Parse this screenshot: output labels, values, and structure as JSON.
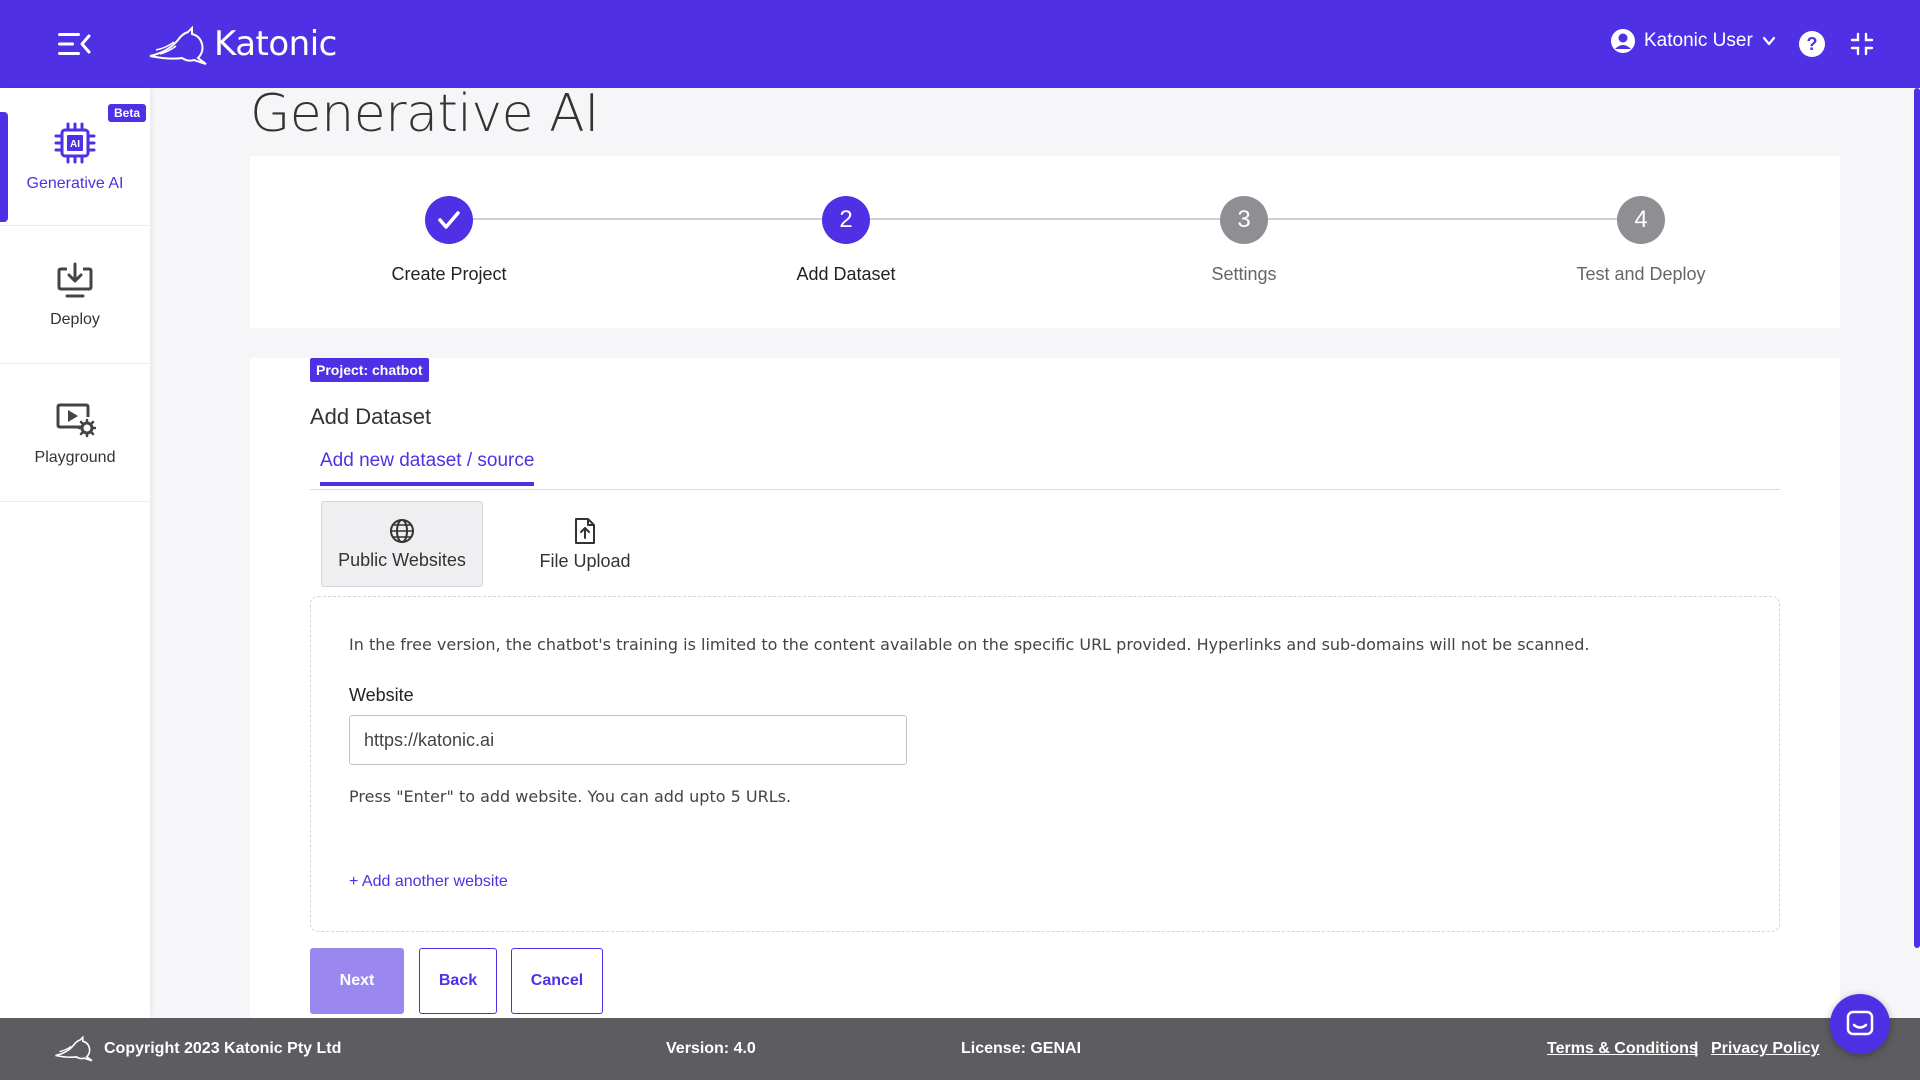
{
  "header": {
    "brand": "Katonic",
    "user_name": "Katonic User"
  },
  "sidebar": {
    "items": [
      {
        "label": "Generative AI",
        "badge": "Beta"
      },
      {
        "label": "Deploy"
      },
      {
        "label": "Playground"
      }
    ]
  },
  "page": {
    "title": "Generative AI"
  },
  "stepper": {
    "steps": [
      {
        "number": "1",
        "label": "Create Project",
        "state": "done"
      },
      {
        "number": "2",
        "label": "Add Dataset",
        "state": "current"
      },
      {
        "number": "3",
        "label": "Settings",
        "state": "todo"
      },
      {
        "number": "4",
        "label": "Test and Deploy",
        "state": "todo"
      }
    ]
  },
  "content": {
    "project_badge": "Project: chatbot",
    "section_title": "Add Dataset",
    "tab_label": "Add new dataset / source",
    "sources": [
      {
        "label": "Public Websites",
        "selected": true
      },
      {
        "label": "File Upload",
        "selected": false
      }
    ],
    "info_text": "In the free version, the chatbot's training is limited to the content available on the specific URL provided. Hyperlinks and sub-domains will not be scanned.",
    "website_label": "Website",
    "website_value": "https://katonic.ai",
    "hint_text": "Press \"Enter\" to add website. You can add upto 5 URLs.",
    "add_link": "+ Add another website"
  },
  "actions": {
    "next": "Next",
    "back": "Back",
    "cancel": "Cancel"
  },
  "footer": {
    "copyright": "Copyright 2023 Katonic Pty Ltd",
    "version": "Version: 4.0",
    "license": "License: GENAI",
    "terms": "Terms & Conditions",
    "separator": "|",
    "privacy": "Privacy Policy"
  },
  "colors": {
    "brand": "#5030e5",
    "next_disabled": "#9b88ef",
    "footer_bg": "#5d5d61"
  }
}
